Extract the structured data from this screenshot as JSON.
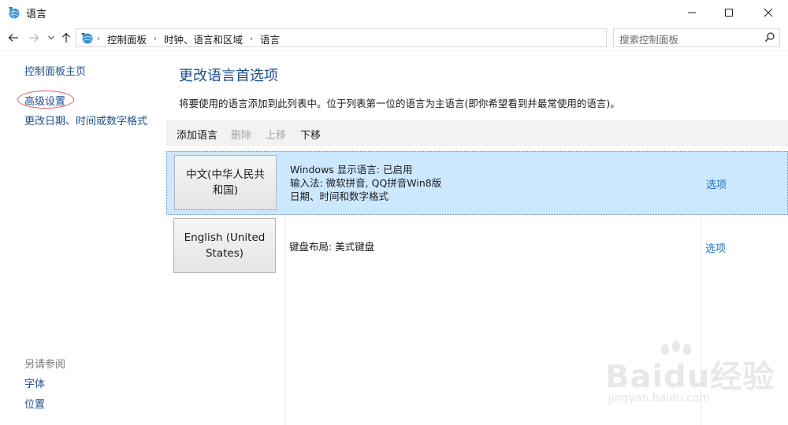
{
  "window": {
    "title": "语言"
  },
  "address": {
    "crumbs": [
      "控制面板",
      "时钟、语言和区域",
      "语言"
    ]
  },
  "search": {
    "placeholder": "搜索控制面板"
  },
  "leftnav": {
    "home": "控制面板主页",
    "advanced": "高级设置",
    "date_format": "更改日期、时间或数字格式",
    "see_also": "另请参阅",
    "font": "字体",
    "location": "位置"
  },
  "main": {
    "title": "更改语言首选项",
    "description": "将要使用的语言添加到此列表中。位于列表第一位的语言为主语言(即你希望看到并最常使用的语言)。"
  },
  "toolbar": {
    "add": "添加语言",
    "delete": "删除",
    "move_up": "上移",
    "move_down": "下移"
  },
  "languages": [
    {
      "name_line1": "中文(中华人民共",
      "name_line2": "和国)",
      "detail1": "Windows 显示语言: 已启用",
      "detail2": "输入法: 微软拼音, QQ拼音Win8版",
      "detail3": "日期、时间和数字格式",
      "options": "选项"
    },
    {
      "name_line1": "English (United",
      "name_line2": "States)",
      "detail1": "键盘布局: 美式键盘",
      "options": "选项"
    }
  ],
  "watermark": {
    "brand": "Baidu经验",
    "url": "jingyan.baidu.com"
  }
}
